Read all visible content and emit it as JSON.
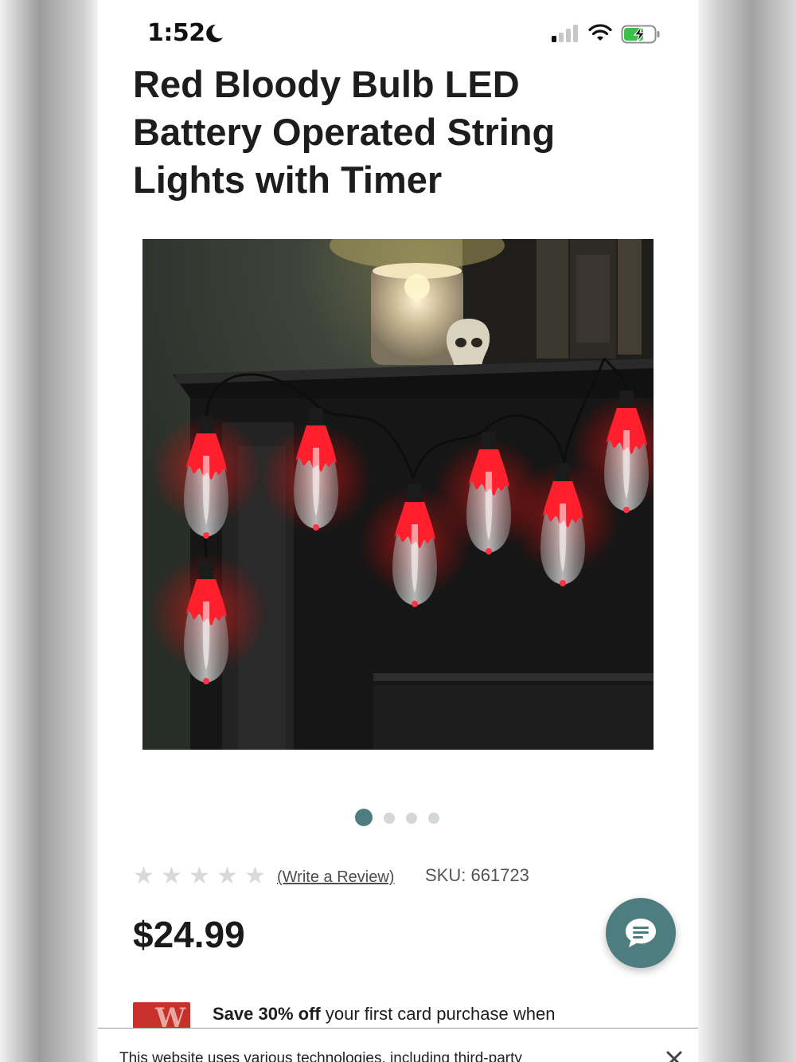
{
  "status_bar": {
    "time": "1:52",
    "icons": [
      "moon-icon",
      "cellular-signal-icon",
      "wifi-icon",
      "battery-charging-icon"
    ]
  },
  "product": {
    "title": "Red Bloody Bulb LED Battery Operated String Lights with Timer",
    "image_alt": "Red bloody bulb LED string lights draped on a dark mantel with candle and skull",
    "carousel": {
      "count": 4,
      "active_index": 0
    },
    "rating": {
      "stars_filled": 0,
      "stars_total": 5,
      "review_link": "(Write a Review)"
    },
    "sku": "SKU: 661723",
    "price": "$24.99"
  },
  "promo": {
    "bold_text": "Save 30% off",
    "text": " your first card purchase when"
  },
  "cookie_banner": {
    "text": "This website uses various technologies, including third-party"
  },
  "colors": {
    "accent": "#4e7d80",
    "dot_inactive": "#d4d7d7",
    "star_empty": "#d9d9d9",
    "card_red": "#c8302b"
  }
}
